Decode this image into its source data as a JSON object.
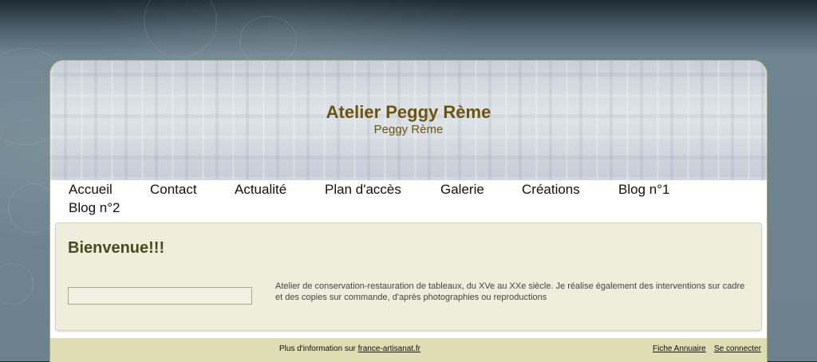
{
  "site": {
    "title": "Atelier Peggy Rème",
    "subtitle": "Peggy Rème"
  },
  "nav": {
    "items": [
      "Accueil",
      "Contact",
      "Actualité",
      "Plan d'accès",
      "Galerie",
      "Créations",
      "Blog n°1",
      "Blog n°2"
    ]
  },
  "main": {
    "heading": "Bienvenue!!!",
    "description": "Atelier de conservation-restauration de tableaux, du XVe au XXe siècle. Je réalise également des interventions sur cadre et des copies sur commande, d'après photographies ou reproductions"
  },
  "footer": {
    "info_prefix": "Plus d'information sur",
    "info_link": "france-artisanat.fr",
    "links": [
      "Fiche Annuaire",
      "Se connecter"
    ]
  },
  "colors": {
    "title": "#6b5510",
    "content_bg": "#efeedd",
    "footer_bg": "#dfddb4",
    "heading": "#4a4a1c"
  }
}
